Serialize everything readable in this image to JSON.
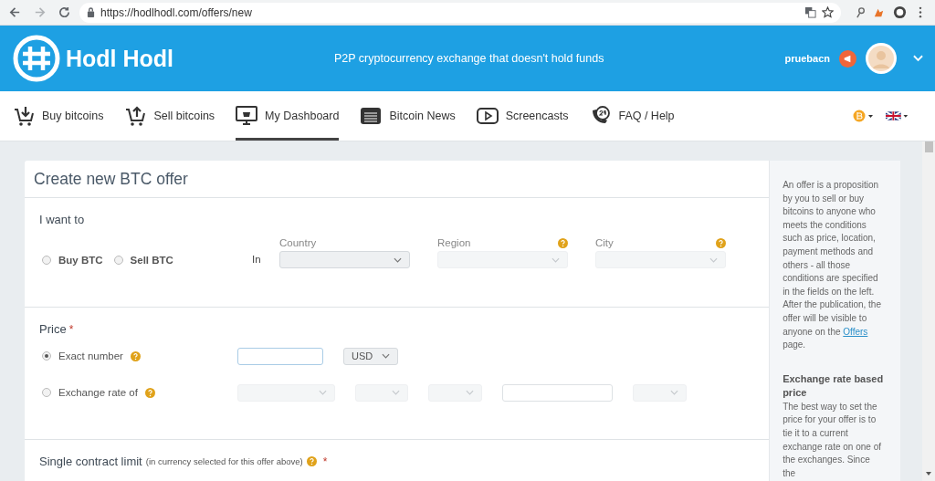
{
  "browser": {
    "url": "https://hodlhodl.com/offers/new"
  },
  "header": {
    "brand": "Hodl Hodl",
    "tagline": "P2P cryptocurrency exchange that doesn't hold funds",
    "username": "pruebacn"
  },
  "nav": {
    "items": [
      {
        "label": "Buy bitcoins",
        "selected": false
      },
      {
        "label": "Sell bitcoins",
        "selected": false
      },
      {
        "label": "My Dashboard",
        "selected": true
      },
      {
        "label": "Bitcoin News",
        "selected": false
      },
      {
        "label": "Screencasts",
        "selected": false
      },
      {
        "label": "FAQ / Help",
        "selected": false
      }
    ]
  },
  "form": {
    "title": "Create new BTC offer",
    "want": {
      "label": "I want to",
      "options": [
        {
          "label": "Buy BTC",
          "selected": false
        },
        {
          "label": "Sell BTC",
          "selected": false
        }
      ],
      "in_label": "In",
      "location": [
        {
          "label": "Country",
          "help": false,
          "disabled": false
        },
        {
          "label": "Region",
          "help": true,
          "disabled": true
        },
        {
          "label": "City",
          "help": true,
          "disabled": true
        }
      ]
    },
    "price": {
      "label": "Price",
      "required_mark": "*",
      "options": [
        {
          "label": "Exact number",
          "selected": true,
          "controls": [
            {
              "kind": "input"
            },
            {
              "kind": "select",
              "value": "USD",
              "disabled": false
            }
          ]
        },
        {
          "label": "Exchange rate of",
          "selected": false,
          "controls": [
            {
              "kind": "select",
              "disabled": true
            },
            {
              "kind": "select",
              "disabled": true
            },
            {
              "kind": "select",
              "disabled": true
            },
            {
              "kind": "input"
            },
            {
              "kind": "select",
              "disabled": true
            }
          ]
        }
      ]
    },
    "limit": {
      "label": "Single contract limit",
      "note": "(in currency selected for this offer above)",
      "required_mark": "*"
    }
  },
  "sidebar": {
    "intro": {
      "before": "An offer is a proposition by you to sell or buy bitcoins to anyone who meets the conditions such as price, location, payment methods and others - all those conditions are specified in the fields on the left. After the publication, the offer will be visible to anyone on the ",
      "link": "Offers",
      "after": " page."
    },
    "heading": "Exchange rate based price",
    "text": "The best way to set the price for your offer is to tie it to a current exchange rate on one of the exchanges. Since the"
  }
}
